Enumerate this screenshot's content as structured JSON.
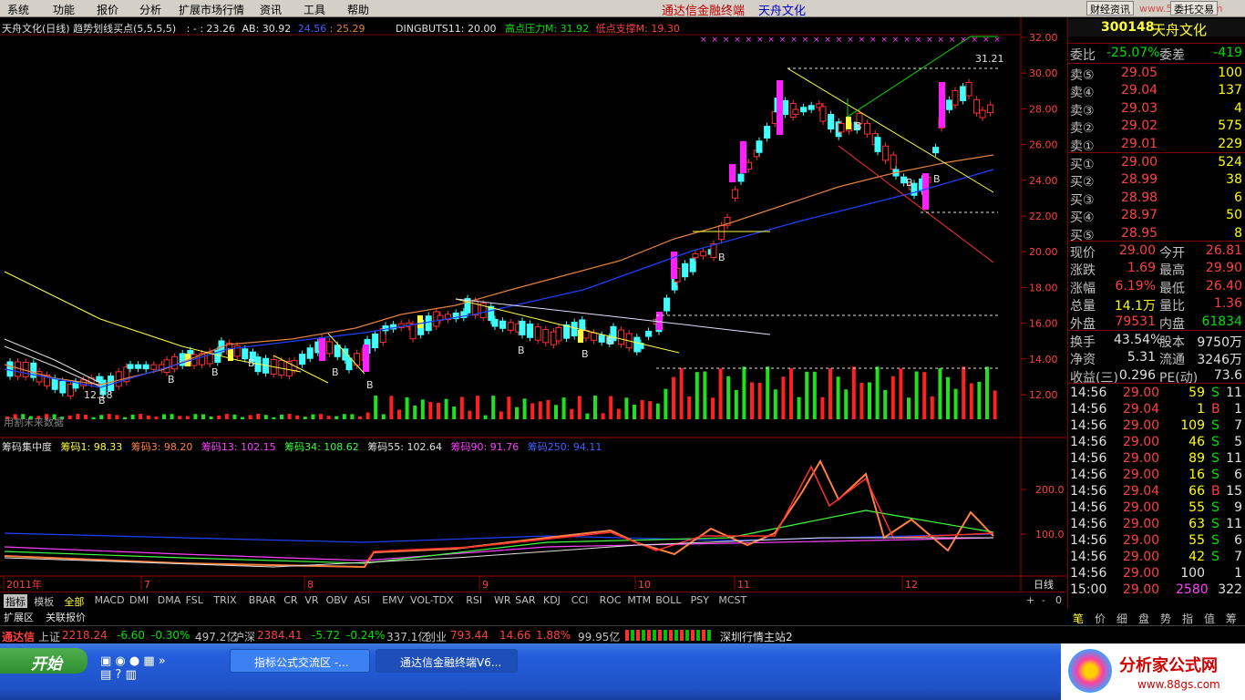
{
  "menu": [
    "系统",
    "功能",
    "报价",
    "分析",
    "扩展市场行情",
    "资讯",
    "工具",
    "帮助"
  ],
  "app_title": "通达信金融终端",
  "stock_title": "天舟文化",
  "top_buttons": [
    "财经资讯",
    "委托交易"
  ],
  "watermark_text": "www.55188.com",
  "main_header": {
    "left": "天舟文化(日线) 趋势划线买点(5,5,5,5)",
    "v1": ": - : 23.26",
    "v2": "AB: 30.92",
    "v3": "24.56",
    "v4": ": 25.29",
    "v5": "DINGBUTS11: 20.00",
    "v6": "高点压力M: 31.92",
    "v7": "低点支撑M: 19.30"
  },
  "price_axis": [
    "32.00",
    "30.00",
    "28.00",
    "26.00",
    "24.00",
    "22.00",
    "20.00",
    "18.00",
    "16.00",
    "14.00",
    "12.00"
  ],
  "indicator_axis": [
    "200.0",
    "100.0"
  ],
  "point_labels": {
    "high": "31.21",
    "low": "12.18",
    "buy": "B"
  },
  "future_text": "用割未来数据",
  "indicator_header": {
    "name": "筹码集中度",
    "c1": "筹码1: 98.33",
    "c3": "筹码3: 98.20",
    "c13": "筹码13: 102.15",
    "c34": "筹码34: 108.62",
    "c55": "筹码55: 102.64",
    "c90": "筹码90: 91.76",
    "c250": "筹码250: 94.11"
  },
  "time_axis": [
    "2011年",
    "7",
    "8",
    "9",
    "10",
    "11",
    "12"
  ],
  "tabs": [
    "指标",
    "模板",
    "全部",
    "MACD",
    "DMI",
    "DMA",
    "FSL",
    "TRIX",
    "BRAR",
    "CR",
    "VR",
    "OBV",
    "ASI",
    "EMV",
    "VOL-TDX",
    "RSI",
    "WR",
    "SAR",
    "KDJ",
    "CCI",
    "ROC",
    "MTM",
    "BOLL",
    "PSY",
    "MCST"
  ],
  "tab_right": [
    "日线",
    "+",
    "-",
    "0"
  ],
  "tabs2": [
    "扩展区",
    "关联报价"
  ],
  "right": {
    "code": "300148",
    "name": "天舟文化",
    "weibi_label": "委比",
    "weibi": "-25.07%",
    "weicha_label": "委差",
    "weicha": "-419",
    "asks": [
      {
        "label": "卖⑤",
        "price": "29.05",
        "vol": "100"
      },
      {
        "label": "卖④",
        "price": "29.04",
        "vol": "137"
      },
      {
        "label": "卖③",
        "price": "29.03",
        "vol": "4"
      },
      {
        "label": "卖②",
        "price": "29.02",
        "vol": "575"
      },
      {
        "label": "卖①",
        "price": "29.01",
        "vol": "229"
      }
    ],
    "bids": [
      {
        "label": "买①",
        "price": "29.00",
        "vol": "524"
      },
      {
        "label": "买②",
        "price": "28.99",
        "vol": "38"
      },
      {
        "label": "买③",
        "price": "28.98",
        "vol": "6"
      },
      {
        "label": "买④",
        "price": "28.97",
        "vol": "50"
      },
      {
        "label": "买⑤",
        "price": "28.95",
        "vol": "8"
      }
    ],
    "quote": [
      {
        "l1": "现价",
        "v1": "29.00",
        "l2": "今开",
        "v2": "26.81",
        "c1": "red",
        "c2": "red"
      },
      {
        "l1": "涨跌",
        "v1": "1.69",
        "l2": "最高",
        "v2": "29.90",
        "c1": "red",
        "c2": "red"
      },
      {
        "l1": "涨幅",
        "v1": "6.19%",
        "l2": "最低",
        "v2": "26.40",
        "c1": "red",
        "c2": "red"
      },
      {
        "l1": "总量",
        "v1": "14.1万",
        "l2": "量比",
        "v2": "1.36",
        "c1": "yel",
        "c2": "red"
      },
      {
        "l1": "外盘",
        "v1": "79531",
        "l2": "内盘",
        "v2": "61834",
        "c1": "red",
        "c2": "grn"
      }
    ],
    "stats": [
      {
        "l1": "换手",
        "v1": "43.54%",
        "l2": "股本",
        "v2": "9750万"
      },
      {
        "l1": "净资",
        "v1": "5.31",
        "l2": "流通",
        "v2": "3246万"
      },
      {
        "l1": "收益(三)",
        "v1": "0.296",
        "l2": "PE(动)",
        "v2": "73.6"
      }
    ],
    "ticks": [
      {
        "t": "14:56",
        "p": "29.00",
        "v": "59",
        "f": "S",
        "n": "11"
      },
      {
        "t": "14:56",
        "p": "29.04",
        "v": "1",
        "f": "B",
        "n": "1"
      },
      {
        "t": "14:56",
        "p": "29.00",
        "v": "109",
        "f": "S",
        "n": "7"
      },
      {
        "t": "14:56",
        "p": "29.00",
        "v": "46",
        "f": "S",
        "n": "5"
      },
      {
        "t": "14:56",
        "p": "29.00",
        "v": "89",
        "f": "S",
        "n": "11"
      },
      {
        "t": "14:56",
        "p": "29.00",
        "v": "16",
        "f": "S",
        "n": "6"
      },
      {
        "t": "14:56",
        "p": "29.04",
        "v": "66",
        "f": "B",
        "n": "15"
      },
      {
        "t": "14:56",
        "p": "29.00",
        "v": "55",
        "f": "S",
        "n": "9"
      },
      {
        "t": "14:56",
        "p": "29.00",
        "v": "63",
        "f": "S",
        "n": "11"
      },
      {
        "t": "14:56",
        "p": "29.00",
        "v": "55",
        "f": "S",
        "n": "6"
      },
      {
        "t": "14:56",
        "p": "29.00",
        "v": "42",
        "f": "S",
        "n": "7"
      },
      {
        "t": "14:56",
        "p": "29.00",
        "v": "100",
        "f": "",
        "n": "1"
      },
      {
        "t": "15:00",
        "p": "29.00",
        "v": "2580",
        "f": "",
        "n": "322"
      }
    ],
    "bottom_tabs": [
      "笔",
      "价",
      "细",
      "盘",
      "势",
      "指",
      "值",
      "筹"
    ]
  },
  "status": {
    "brand": "通达信",
    "sh_label": "上证",
    "sh": "2218.24",
    "sh_chg": "-6.60",
    "sh_pct": "-0.30%",
    "sh_amt": "497.2亿",
    "hs_label": "沪深",
    "hs": "2384.41",
    "hs_chg": "-5.72",
    "hs_pct": "-0.24%",
    "hs_amt": "337.1亿",
    "cy_label": "创业",
    "cy": "793.44",
    "cy_chg": "14.66",
    "cy_pct": "1.88%",
    "cy_amt": "99.95亿",
    "server": "深圳行情主站2"
  },
  "taskbar": {
    "start": "开始",
    "tasks": [
      "指标公式交流区 -...",
      "通达信金融终端V6..."
    ]
  },
  "logo": {
    "text": "分析家公式网",
    "url": "www.88gs.com"
  }
}
